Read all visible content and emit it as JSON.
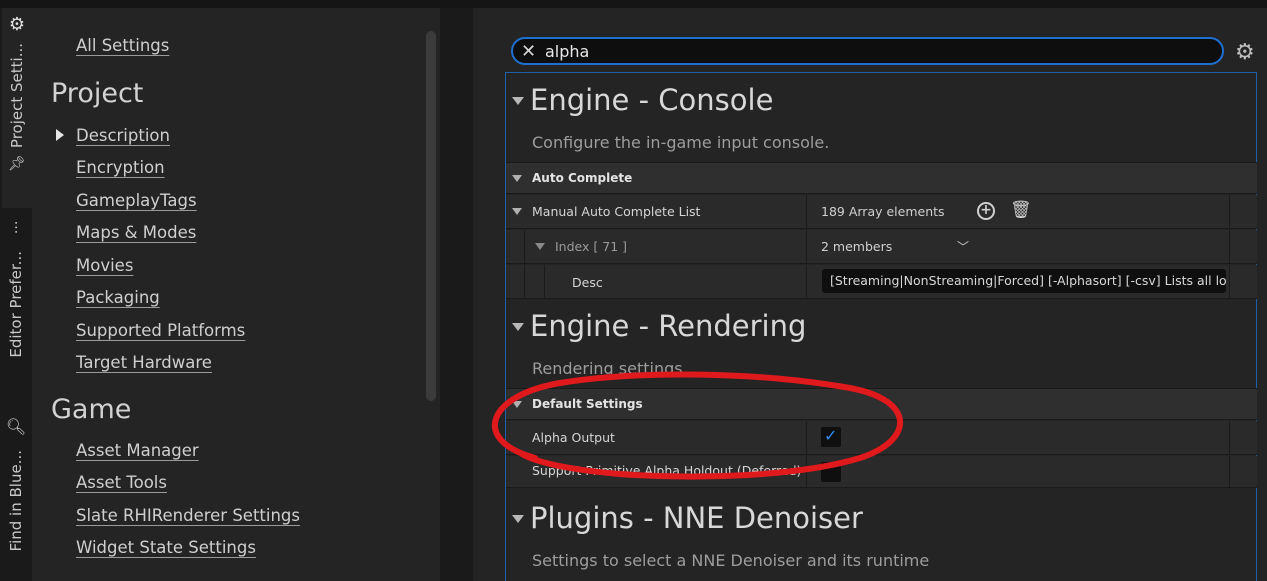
{
  "side_tabs": [
    {
      "label": "Project Setti..."
    },
    {
      "label": "Editor Prefer..."
    },
    {
      "label": "Find in Blue..."
    }
  ],
  "nav": {
    "all_settings": "All Settings",
    "project_header": "Project",
    "project_items": [
      "Description",
      "Encryption",
      "GameplayTags",
      "Maps & Modes",
      "Movies",
      "Packaging",
      "Supported Platforms",
      "Target Hardware"
    ],
    "game_header": "Game",
    "game_items": [
      "Asset Manager",
      "Asset Tools",
      "Slate RHIRenderer Settings",
      "Widget State Settings"
    ]
  },
  "search": {
    "value": "alpha"
  },
  "sections": {
    "console": {
      "title": "Engine - Console",
      "description": "Configure the in-game input console.",
      "category": "Auto Complete",
      "list_name": "Manual Auto Complete List",
      "list_value": "189 Array elements",
      "index_label": "Index [ 71 ]",
      "index_value": "2 members",
      "desc_name": "Desc",
      "desc_value": "[Streaming|NonStreaming|Forced] [-Alphasort] [-csv] Lists all loade"
    },
    "rendering": {
      "title": "Engine - Rendering",
      "description": "Rendering settings.",
      "category": "Default Settings",
      "alpha_output": "Alpha Output",
      "alpha_output_checked": true,
      "holdout": "Support Primitive Alpha Holdout (Deferred)",
      "holdout_checked": false
    },
    "nne": {
      "title": "Plugins - NNE Denoiser",
      "description": "Settings to select a NNE Denoiser and its runtime"
    }
  },
  "annotation_color": "#e0191c",
  "accent_color": "#1f6fd0"
}
